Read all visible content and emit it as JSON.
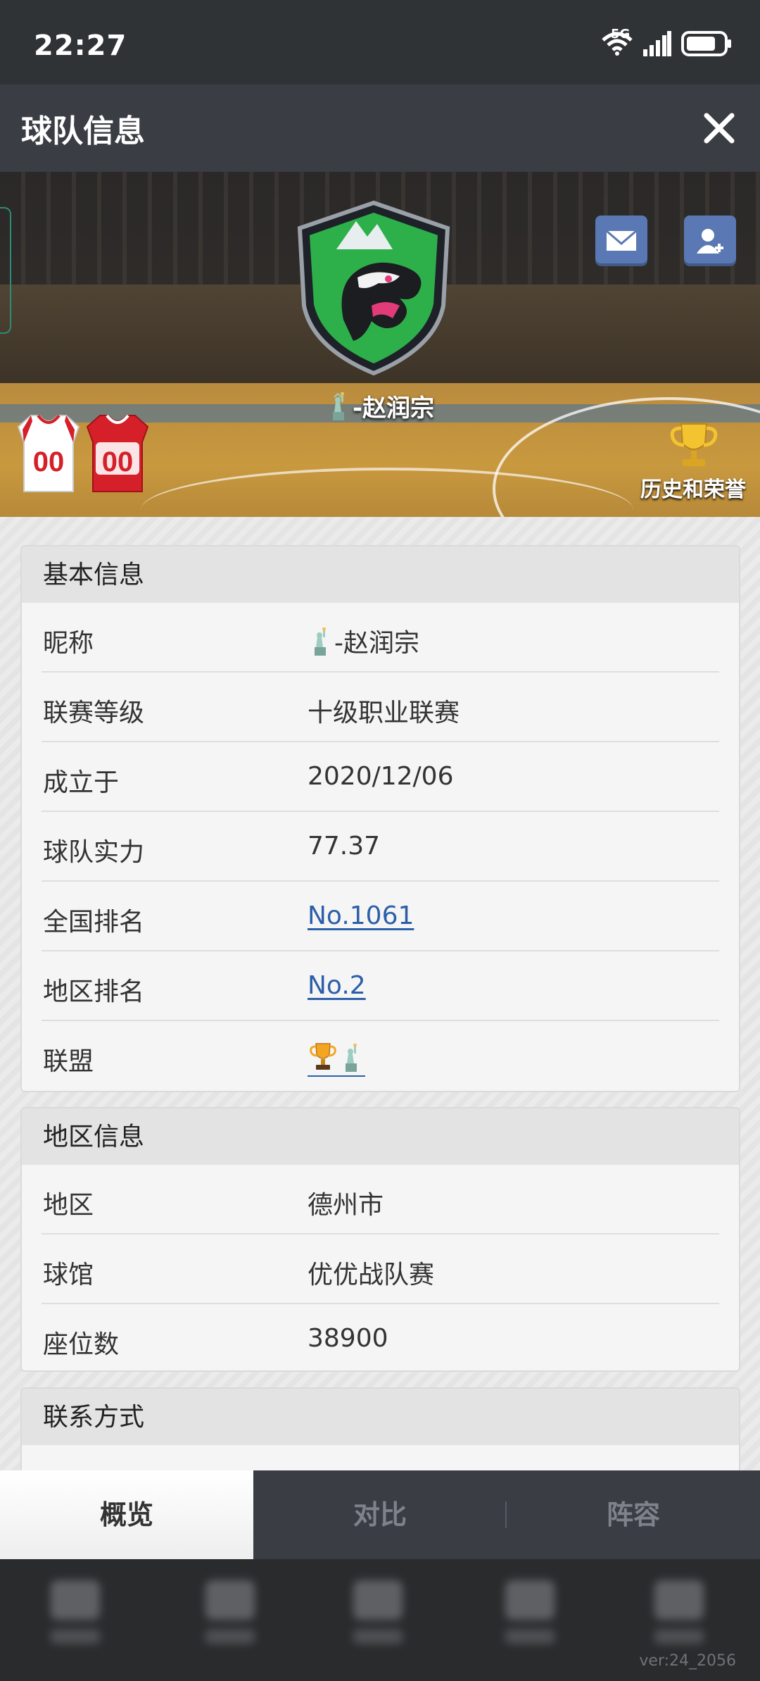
{
  "status_bar": {
    "time": "22:27",
    "network": "5G",
    "icons": [
      "wifi-icon",
      "signal-icon",
      "battery-icon"
    ]
  },
  "header": {
    "title": "球队信息",
    "close_icon": "close-icon"
  },
  "hero": {
    "team_name": "-赵润宗",
    "team_name_icon": "statue-of-liberty-icon",
    "logo": "dragon-shield-logo",
    "jersey_numbers": [
      "00",
      "00"
    ],
    "honor_label": "历史和荣誉",
    "buttons": [
      "mail-icon",
      "add-friend-icon"
    ]
  },
  "basic_info": {
    "title": "基本信息",
    "rows": [
      {
        "label": "昵称",
        "value": "-赵润宗"
      },
      {
        "label": "联赛等级",
        "value": "十级职业联赛"
      },
      {
        "label": "成立于",
        "value": "2020/12/06"
      },
      {
        "label": "球队实力",
        "value": "77.37"
      },
      {
        "label": "全国排名",
        "value": "No.1061"
      },
      {
        "label": "地区排名",
        "value": "No.2"
      },
      {
        "label": "联盟",
        "value": ""
      }
    ]
  },
  "region_info": {
    "title": "地区信息",
    "rows": [
      {
        "label": "地区",
        "value": "德州市"
      },
      {
        "label": "球馆",
        "value": "优优战队赛"
      },
      {
        "label": "座位数",
        "value": "38900"
      }
    ]
  },
  "contact_info": {
    "title": "联系方式"
  },
  "tabs": [
    {
      "label": "概览",
      "active": true
    },
    {
      "label": "对比",
      "active": false
    },
    {
      "label": "阵容",
      "active": false
    }
  ],
  "footer": {
    "version": "ver:24_2056"
  },
  "colors": {
    "header_bg": "#3a3d44",
    "link": "#2c5fa9",
    "button_blue": "#5a78b4",
    "jersey_red": "#d5202a"
  }
}
